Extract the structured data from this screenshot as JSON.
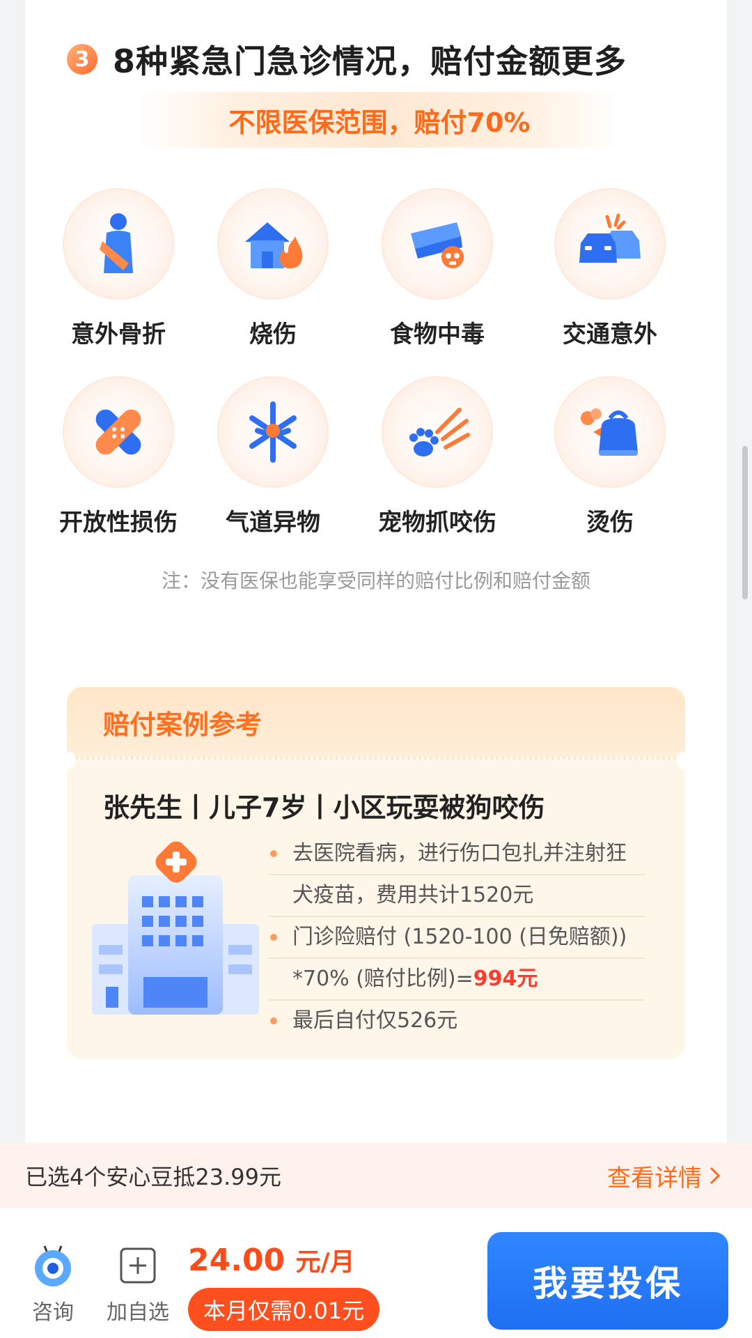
{
  "section": {
    "number": "3",
    "title": "8种紧急门急诊情况，赔付金额更多",
    "banner": "不限医保范围，赔付70%"
  },
  "conditions": [
    {
      "label": "意外骨折",
      "icon": "arm-sling-icon"
    },
    {
      "label": "烧伤",
      "icon": "house-fire-icon"
    },
    {
      "label": "食物中毒",
      "icon": "poison-food-icon"
    },
    {
      "label": "交通意外",
      "icon": "car-crash-icon"
    },
    {
      "label": "开放性损伤",
      "icon": "bandage-icon"
    },
    {
      "label": "气道异物",
      "icon": "airway-icon"
    },
    {
      "label": "宠物抓咬伤",
      "icon": "paw-scratch-icon"
    },
    {
      "label": "烫伤",
      "icon": "kettle-icon"
    }
  ],
  "note": "注：没有医保也能享受同样的赔付比例和赔付金额",
  "case": {
    "header": "赔付案例参考",
    "title": "张先生丨儿子7岁丨小区玩耍被狗咬伤",
    "line1a": "去医院看病，进行伤口包扎并注射狂",
    "line1b": "犬疫苗，费用共计1520元",
    "line2a": "门诊险赔付 (1520-100 (日免赔额))",
    "line2b_prefix": "*70% (赔付比例)=",
    "line2b_amount": "994元",
    "line3": "最后自付仅526元"
  },
  "strip": {
    "left": "已选4个安心豆抵23.99元",
    "right": "查看详情"
  },
  "bottom": {
    "consult": "咨询",
    "add": "加自选",
    "price_value": "24.00",
    "price_unit": "元/月",
    "promo": "本月仅需0.01元",
    "buy": "我要投保"
  },
  "colors": {
    "accent": "#ff6a1a",
    "primary_button": "#2f86ff",
    "highlight_red": "#ff3b2f"
  }
}
